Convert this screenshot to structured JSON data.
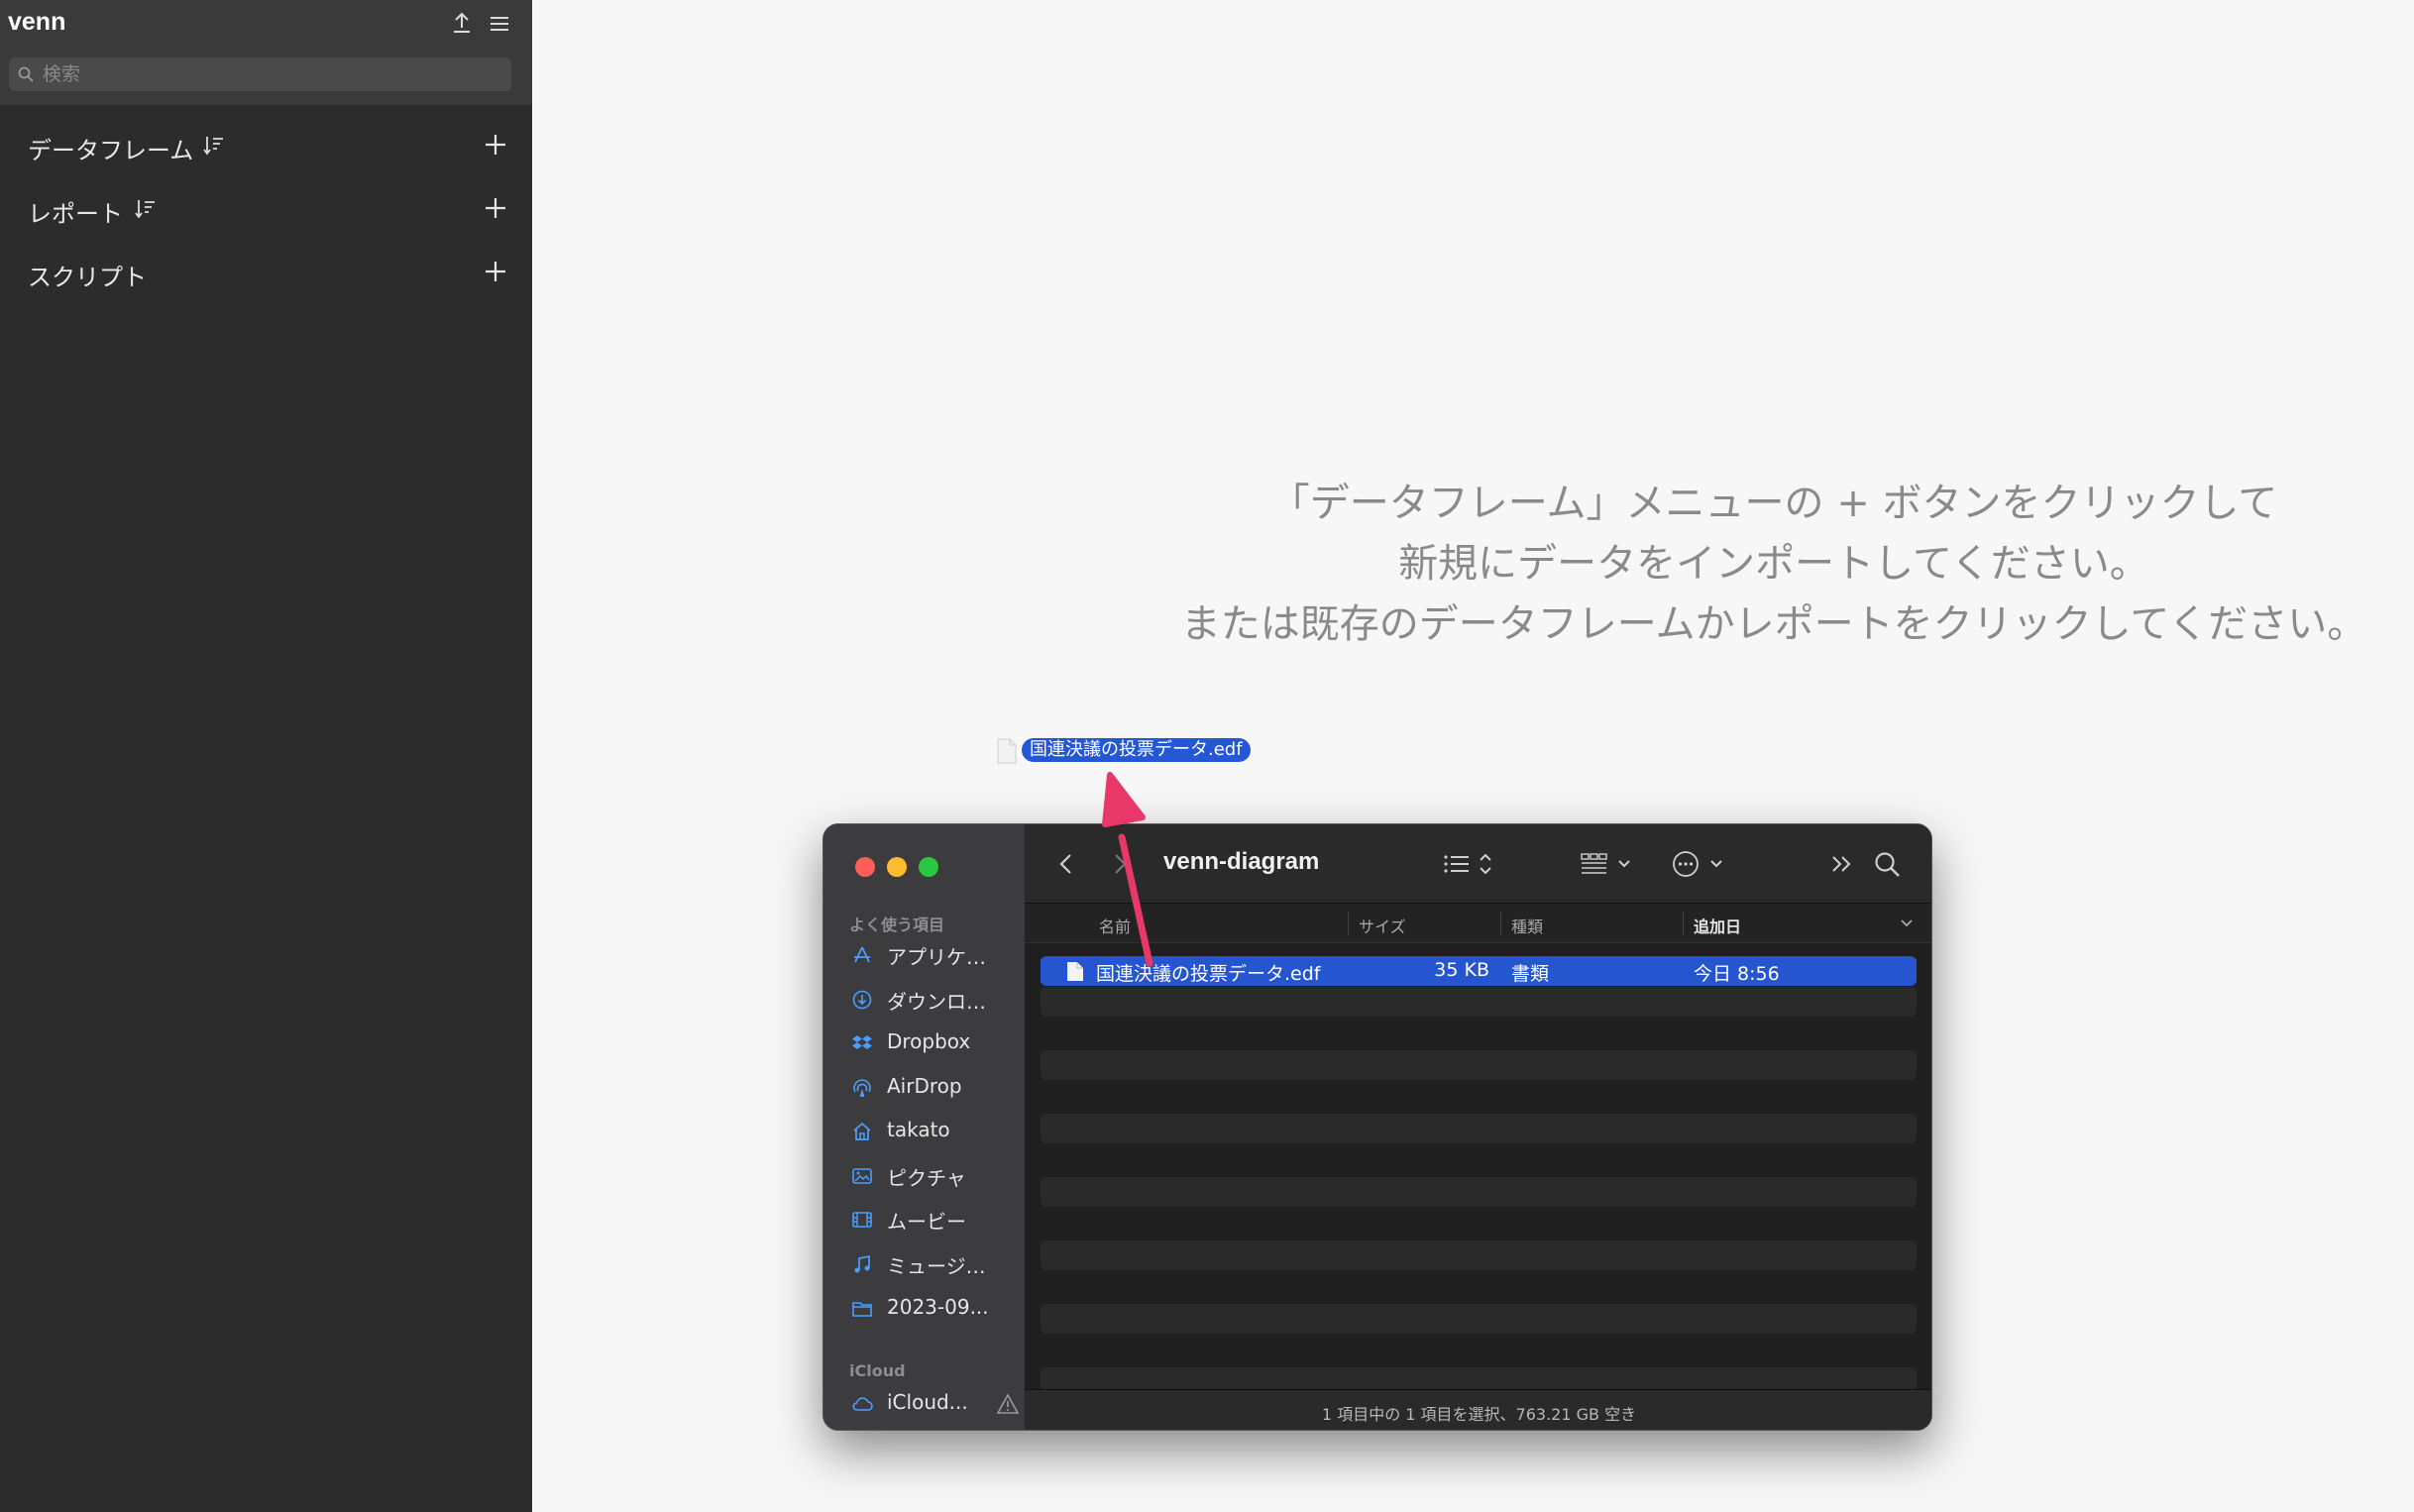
{
  "app": {
    "title": "venn",
    "search_placeholder": "検索",
    "sections": [
      {
        "label": "データフレーム"
      },
      {
        "label": "レポート"
      },
      {
        "label": "スクリプト"
      }
    ]
  },
  "main": {
    "message_lines": [
      "「データフレーム」メニューの + ボタンをクリックして",
      "新規にデータをインポートしてください。",
      "または既存のデータフレームかレポートをクリックしてください。"
    ],
    "dragged_file": "国連決議の投票データ.edf"
  },
  "finder": {
    "title": "venn-diagram",
    "favorites_label": "よく使う項目",
    "favorites": [
      {
        "label": "アプリケ…",
        "icon": "applications-icon"
      },
      {
        "label": "ダウンロ…",
        "icon": "downloads-icon"
      },
      {
        "label": "Dropbox",
        "icon": "dropbox-icon"
      },
      {
        "label": "AirDrop",
        "icon": "airdrop-icon"
      },
      {
        "label": "takato",
        "icon": "home-icon"
      },
      {
        "label": "ピクチャ",
        "icon": "pictures-icon"
      },
      {
        "label": "ムービー",
        "icon": "movies-icon"
      },
      {
        "label": "ミュージ…",
        "icon": "music-icon"
      },
      {
        "label": "2023-09...",
        "icon": "folder-icon"
      }
    ],
    "icloud_label": "iCloud",
    "icloud_item": "iCloud...",
    "columns": {
      "name": "名前",
      "size": "サイズ",
      "kind": "種類",
      "date": "追加日"
    },
    "files": [
      {
        "name": "国連決議の投票データ.edf",
        "size": "35 KB",
        "kind": "書類",
        "date": "今日 8:56"
      }
    ],
    "status": "1 項目中の 1 項目を選択、763.21 GB 空き"
  },
  "colors": {
    "selection": "#2556cf",
    "arrow": "#e8386a",
    "sidebar_bg": "#2c2c2c"
  }
}
